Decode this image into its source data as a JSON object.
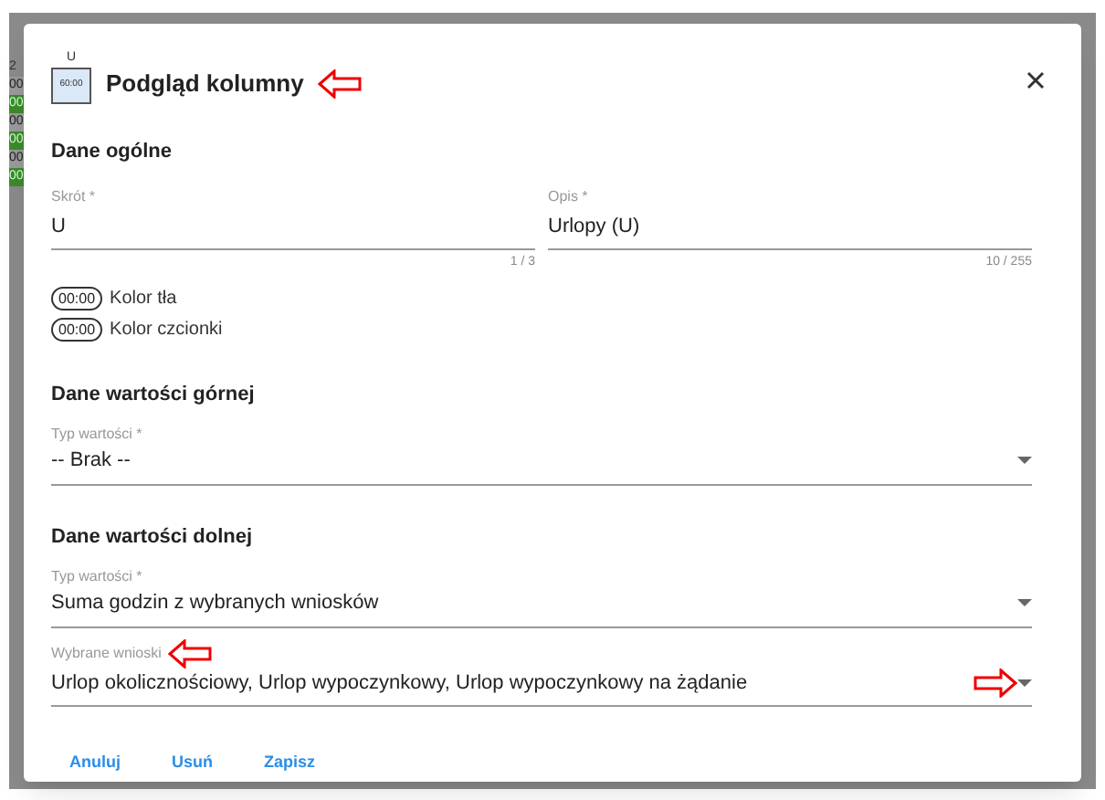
{
  "backdrop": {
    "header": "2",
    "cells": [
      {
        "text": "00",
        "kind": "plain"
      },
      {
        "text": "00",
        "kind": "green"
      },
      {
        "text": "00",
        "kind": "plain"
      },
      {
        "text": "00",
        "kind": "green"
      },
      {
        "text": "00",
        "kind": "plain"
      },
      {
        "text": "00",
        "kind": "green"
      }
    ]
  },
  "dialog": {
    "preview": {
      "label": "U",
      "time": "60:00"
    },
    "title": "Podgląd kolumny"
  },
  "general": {
    "heading": "Dane ogólne",
    "fields": [
      {
        "label": "Skrót *",
        "value": "U",
        "counter": "1 / 3"
      },
      {
        "label": "Opis *",
        "value": "Urlopy (U)",
        "counter": "10 / 255"
      }
    ],
    "colors": [
      {
        "chip": "00:00",
        "label": "Kolor tła"
      },
      {
        "chip": "00:00",
        "label": "Kolor czcionki"
      }
    ]
  },
  "upper": {
    "heading": "Dane wartości górnej",
    "selects": [
      {
        "label": "Typ wartości *",
        "value": "-- Brak --"
      }
    ]
  },
  "lower": {
    "heading": "Dane wartości dolnej",
    "selects": [
      {
        "label": "Typ wartości *",
        "value": "Suma godzin z wybranych wniosków"
      },
      {
        "label": "Wybrane wnioski",
        "value": "Urlop okolicznościowy, Urlop wypoczynkowy, Urlop wypoczynkowy na żądanie"
      }
    ]
  },
  "actions": [
    "Anuluj",
    "Usuń",
    "Zapisz"
  ]
}
